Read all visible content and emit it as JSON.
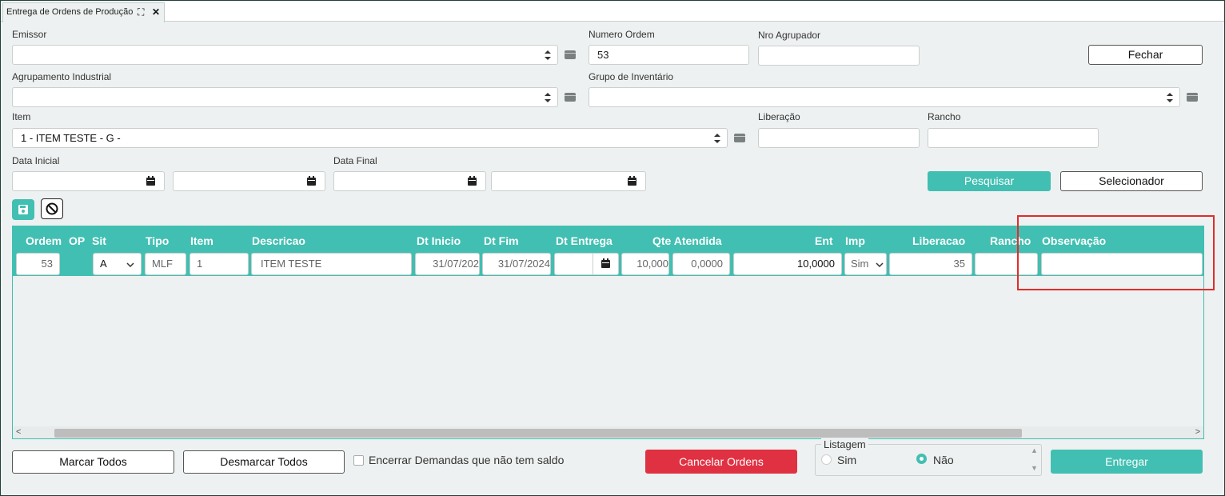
{
  "tab": {
    "title": "Entrega de Ordens de Produção"
  },
  "filters": {
    "emissor_label": "Emissor",
    "numero_ordem_label": "Numero Ordem",
    "numero_ordem_value": "53",
    "nro_agrupador_label": "Nro Agrupador",
    "fechar_label": "Fechar",
    "agrupamento_label": "Agrupamento Industrial",
    "grupo_inventario_label": "Grupo de Inventário",
    "item_label": "Item",
    "item_value": "1 - ITEM TESTE - G -",
    "liberacao_label": "Liberação",
    "rancho_label": "Rancho",
    "data_inicial_label": "Data Inicial",
    "data_final_label": "Data Final",
    "pesquisar_label": "Pesquisar",
    "selecionador_label": "Selecionador"
  },
  "grid": {
    "headers": [
      "Ordem",
      "OP",
      "Sit",
      "Tipo",
      "Item",
      "Descricao",
      "Dt Inicio",
      "Dt Fim",
      "Dt Entrega",
      "Qte Atendida",
      "Ent",
      "Imp",
      "Liberacao",
      "Rancho",
      "Observação"
    ],
    "row": {
      "ordem": "53",
      "sit": "A",
      "tipo": "MLF",
      "item": "1",
      "descricao": "ITEM TESTE",
      "dt_inicio": "31/07/202",
      "dt_fim": "31/07/2024",
      "qte1": "10,000",
      "qte2": "0,0000",
      "ent": "10,0000",
      "imp": "Sim",
      "liberacao": "35",
      "rancho": "",
      "observacao": ""
    }
  },
  "footer": {
    "marcar_todos": "Marcar Todos",
    "desmarcar_todos": "Desmarcar Todos",
    "encerrar_label": "Encerrar Demandas que não tem saldo",
    "cancelar_label": "Cancelar Ordens",
    "listagem_label": "Listagem",
    "sim_label": "Sim",
    "nao_label": "Não",
    "listagem_selected": "Não",
    "entregar_label": "Entregar"
  },
  "colors": {
    "accent": "#41bfb2",
    "danger": "#e03142",
    "highlight_box": "#e32b2b"
  }
}
